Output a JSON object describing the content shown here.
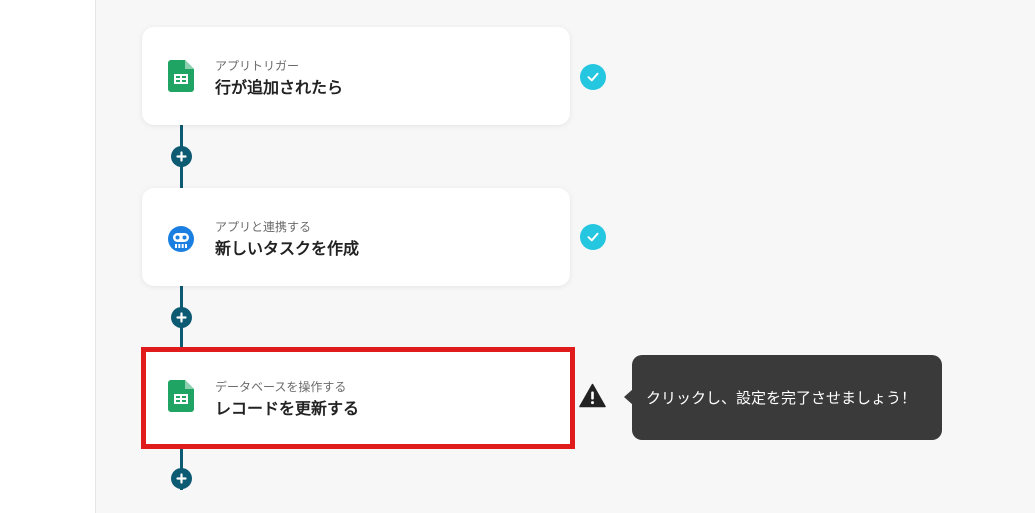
{
  "flow": {
    "steps": [
      {
        "subtitle": "アプリトリガー",
        "title": "行が追加されたら",
        "icon": "google-sheets-icon",
        "status": "complete"
      },
      {
        "subtitle": "アプリと連携する",
        "title": "新しいタスクを作成",
        "icon": "robot-app-icon",
        "status": "complete"
      },
      {
        "subtitle": "データベースを操作する",
        "title": "レコードを更新する",
        "icon": "google-sheets-icon",
        "status": "warning"
      }
    ]
  },
  "tooltip": {
    "text": "クリックし、設定を完了させましょう！"
  },
  "colors": {
    "connector": "#0d5a73",
    "check": "#25c6e0",
    "highlight": "#e01b1b",
    "sheets_green": "#1fa463",
    "robot_blue": "#1a7fe0",
    "tooltip_bg": "#3a3a3a"
  }
}
